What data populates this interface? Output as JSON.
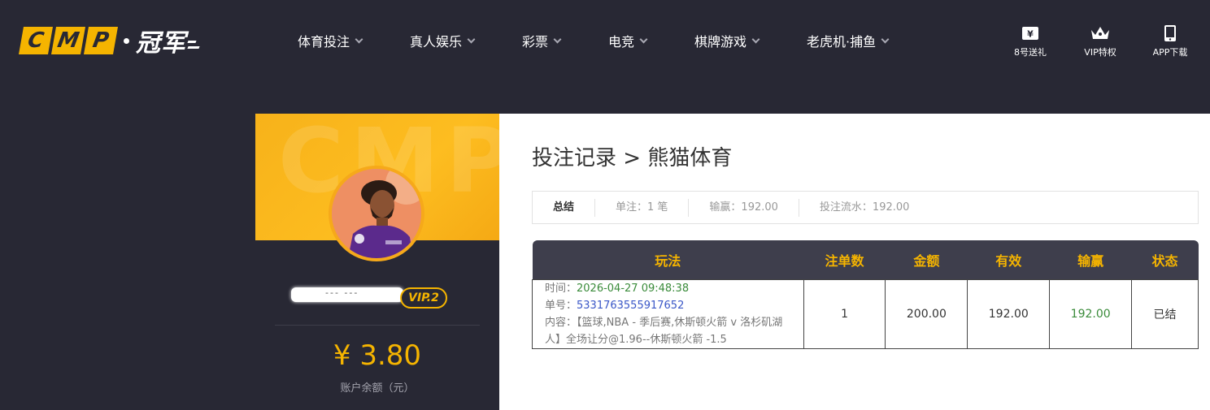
{
  "header": {
    "logo_letters": [
      "C",
      "M",
      "P"
    ],
    "logo_cn": "冠军",
    "nav": [
      {
        "label": "体育投注"
      },
      {
        "label": "真人娱乐"
      },
      {
        "label": "彩票"
      },
      {
        "label": "电竞"
      },
      {
        "label": "棋牌游戏"
      },
      {
        "label": "老虎机·捕鱼"
      }
    ],
    "links": [
      {
        "label": "8号送礼",
        "icon": "ticket-icon"
      },
      {
        "label": "VIP特权",
        "icon": "crown-icon"
      },
      {
        "label": "APP下载",
        "icon": "phone-icon"
      }
    ]
  },
  "sidebar": {
    "banner_watermark": "CMP",
    "username_masked": "--- ---",
    "vip": "VIP.2",
    "balance": "¥ 3.80",
    "balance_label": "账户余额（元）"
  },
  "main": {
    "title": "投注记录 > 熊猫体育",
    "summary": {
      "label": "总结",
      "count": "单注：1 笔",
      "winloss": "输赢：192.00",
      "turnover": "投注流水：192.00"
    },
    "table": {
      "headers": [
        "玩法",
        "注单数",
        "金额",
        "有效",
        "输赢",
        "状态"
      ],
      "rows": [
        {
          "time_label": "时间：",
          "time": "2026-04-27 09:48:38",
          "order_label": "单号：",
          "order": "5331763555917652",
          "content_label": "内容：",
          "content": "【篮球,NBA - 季后赛,休斯顿火箭 v 洛杉矶湖人】全场让分@1.96--休斯顿火箭 -1.5",
          "count": "1",
          "amount": "200.00",
          "valid": "192.00",
          "winloss": "192.00",
          "status": "已结"
        }
      ]
    }
  },
  "colors": {
    "accent": "#f5b400",
    "bg_dark": "#282834",
    "table_head": "#3e3e4c",
    "win_green": "#3a8b3a",
    "order_blue": "#3a57c7"
  }
}
